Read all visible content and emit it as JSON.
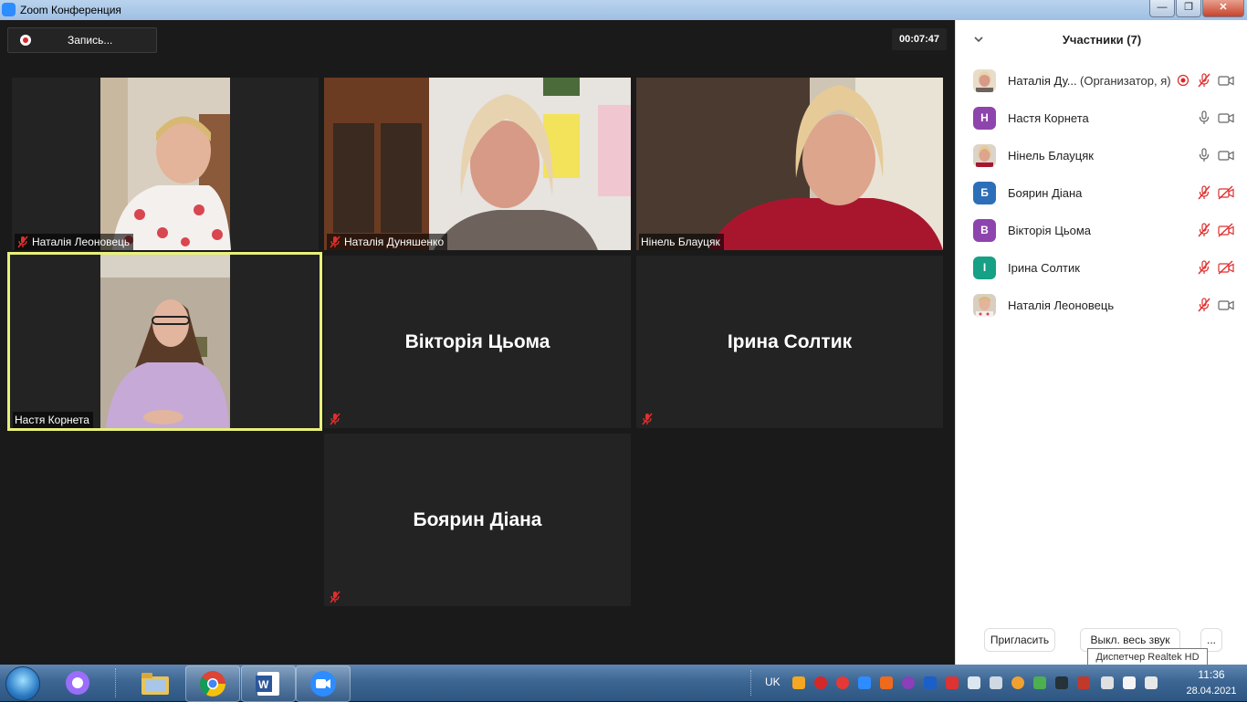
{
  "window": {
    "title": "Zoom Конференция",
    "buttons": {
      "minimize": "—",
      "maximize": "❐",
      "close": "✕"
    }
  },
  "recording": {
    "label": "Запись..."
  },
  "timer": "00:07:47",
  "tiles": [
    {
      "name": "Наталія Леоновець",
      "video": true,
      "muted": true
    },
    {
      "name": "Наталія Дуняшенко",
      "video": true,
      "muted": true
    },
    {
      "name": "Нінель Блауцяк",
      "video": true,
      "muted": false
    },
    {
      "name": "Настя Корнета",
      "video": true,
      "muted": false,
      "active_speaker": true
    },
    {
      "name": "Вікторія Цьома",
      "video": false,
      "muted": true
    },
    {
      "name": "Ірина Солтик",
      "video": false,
      "muted": true
    },
    {
      "name": "Боярин Діана",
      "video": false,
      "muted": true
    }
  ],
  "participants_panel": {
    "title": "Участники (7)",
    "participants": [
      {
        "name": "Наталія Ду...",
        "role": "(Организатор, я)",
        "avatar": "photo",
        "recording": true,
        "mic": "muted",
        "video": "on"
      },
      {
        "name": "Настя Корнета",
        "avatar_letter": "Н",
        "avatar_color": "#8e44ad",
        "mic": "on",
        "video": "on"
      },
      {
        "name": "Нінель Блауцяк",
        "avatar": "photo",
        "mic": "on",
        "video": "on"
      },
      {
        "name": "Боярин Діана",
        "avatar_letter": "Б",
        "avatar_color": "#2c6fb8",
        "mic": "muted",
        "video": "off"
      },
      {
        "name": "Вікторія Цьома",
        "avatar_letter": "В",
        "avatar_color": "#8e44ad",
        "mic": "muted",
        "video": "off"
      },
      {
        "name": "Ірина Солтик",
        "avatar_letter": "І",
        "avatar_color": "#16a085",
        "mic": "muted",
        "video": "off"
      },
      {
        "name": "Наталія Леоновець",
        "avatar": "photo",
        "mic": "muted",
        "video": "on"
      }
    ],
    "buttons": {
      "invite": "Пригласить",
      "mute_all": "Выкл. весь звук",
      "more": "..."
    }
  },
  "tooltip": "Диспетчер Realtek HD",
  "taskbar": {
    "apps": [
      "alice-icon",
      "explorer-icon",
      "chrome-icon",
      "word-icon",
      "zoom-icon"
    ],
    "language": "UK",
    "time": "11:36",
    "date": "28.04.2021"
  },
  "colors": {
    "stage_bg": "#1a1a1a",
    "tile_bg": "#232323",
    "active_border": "#e8f07a",
    "muted_red": "#e02f2f",
    "panel_bg": "#ffffff"
  }
}
